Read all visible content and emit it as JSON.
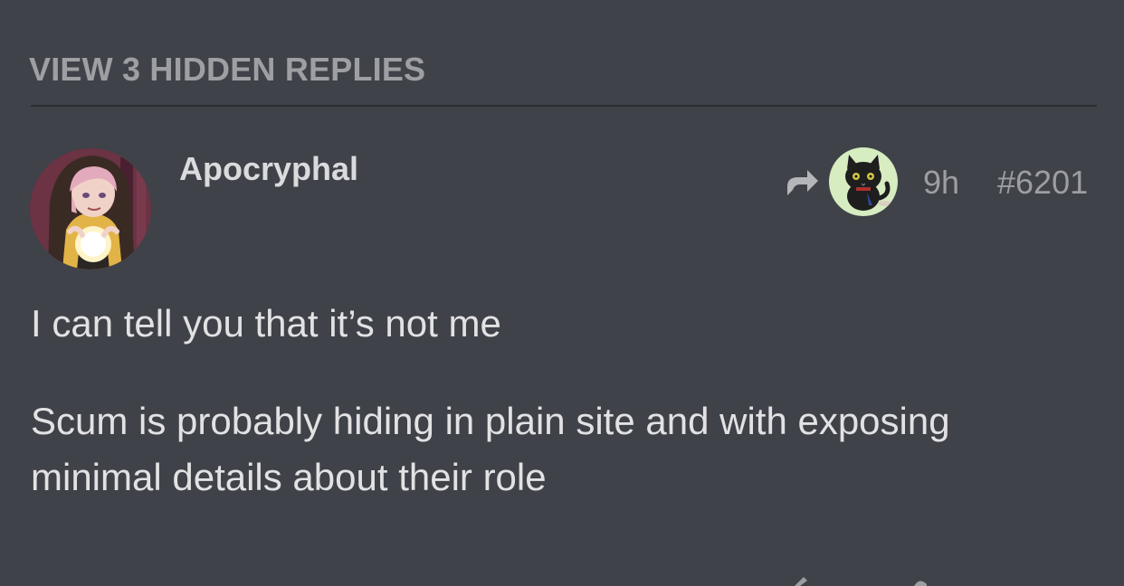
{
  "thread": {
    "hidden_replies_label": "VIEW 3 HIDDEN REPLIES"
  },
  "post": {
    "username": "Apocryphal",
    "avatar_icon": "hooded-figure-with-crystal-ball-avatar",
    "reply_to_icon": "reply-arrow-icon",
    "reply_to_avatar_icon": "black-cat-avatar",
    "time": "9h",
    "post_number": "#6201",
    "paragraphs": [
      "I can tell you that it’s not me",
      "Scum is probably hiding in plain site and with exposing minimal details about their role"
    ]
  },
  "colors": {
    "background": "#404249",
    "muted_text": "#9c9ea2",
    "body_text": "#e2e2e4",
    "divider": "#2d2e33"
  }
}
